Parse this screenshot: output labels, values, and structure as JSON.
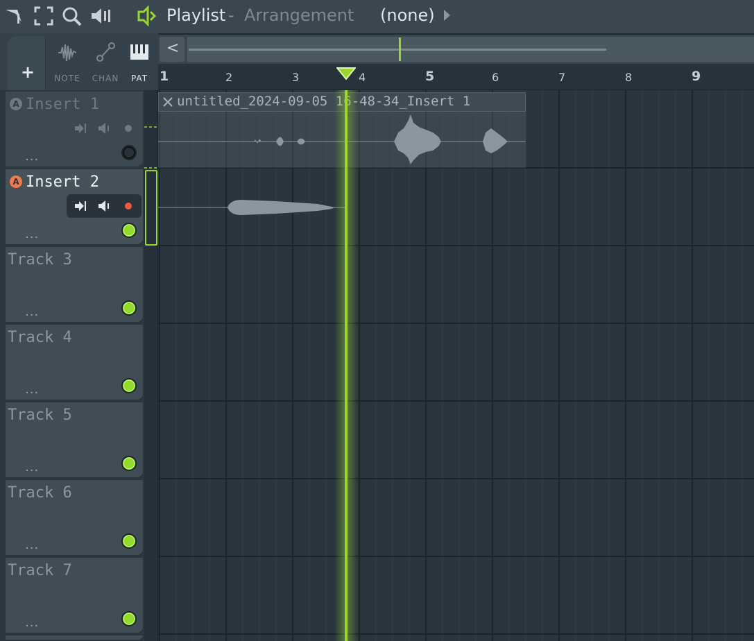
{
  "window": {
    "title": "Playlist",
    "separator": "-",
    "subtitle": "Arrangement",
    "pattern_selector": "(none)"
  },
  "modes": [
    {
      "label": "NOTE",
      "icon": "waveform-icon",
      "active": false
    },
    {
      "label": "CHAN",
      "icon": "channel-link-icon",
      "active": false
    },
    {
      "label": "PAT",
      "icon": "piano-icon",
      "active": true
    }
  ],
  "add_track": "+",
  "scroll": {
    "left_arrow": "<"
  },
  "ruler": {
    "bars": [
      "1",
      "2",
      "3",
      "4",
      "5",
      "6",
      "7",
      "8",
      "9"
    ]
  },
  "tracks": [
    {
      "name": "Insert 1",
      "badge": "A",
      "more": "...",
      "enabled": false
    },
    {
      "name": "Insert 2",
      "badge": "A",
      "more": "...",
      "enabled": true,
      "selected": true
    },
    {
      "name": "Track 3",
      "more": "...",
      "enabled": true
    },
    {
      "name": "Track 4",
      "more": "...",
      "enabled": true
    },
    {
      "name": "Track 5",
      "more": "...",
      "enabled": true
    },
    {
      "name": "Track 6",
      "more": "...",
      "enabled": true
    },
    {
      "name": "Track 7",
      "more": "...",
      "enabled": true
    }
  ],
  "clip": {
    "title": "untitled_2024-09-05 16-48-34_Insert 1"
  },
  "colors": {
    "accent": "#9ad72e",
    "record": "#f05a3a",
    "bg": "#1f2a31"
  }
}
